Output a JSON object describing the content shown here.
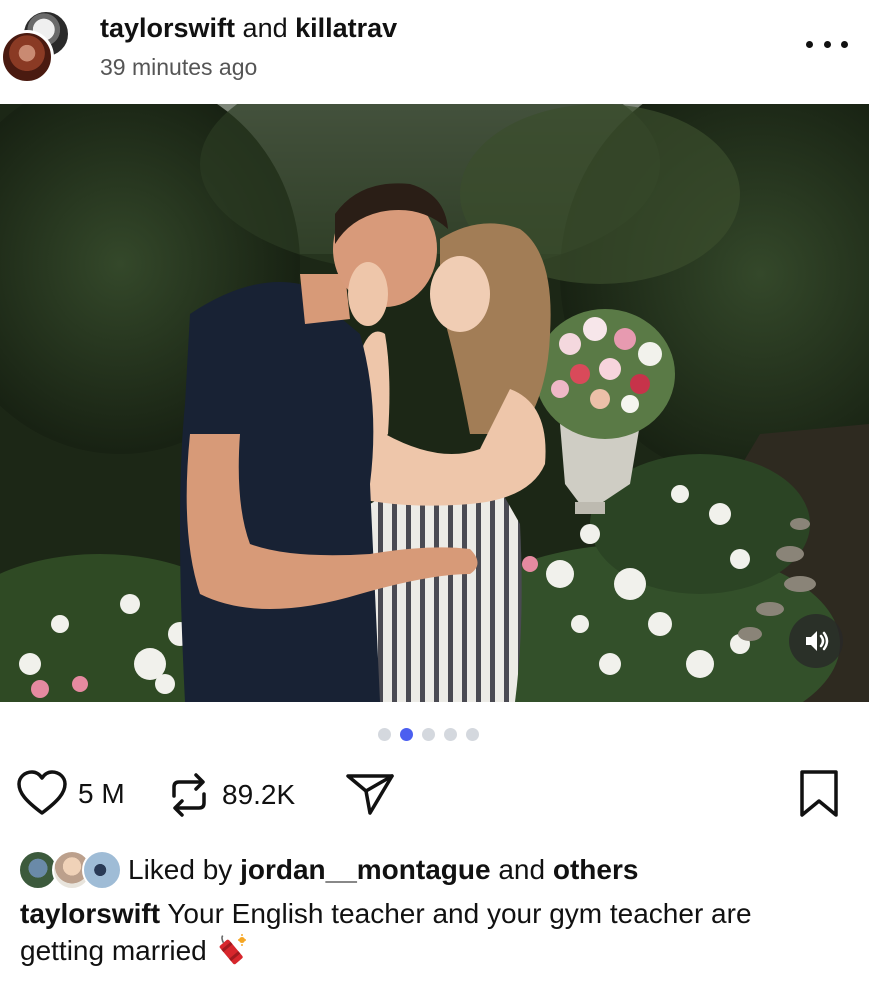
{
  "post": {
    "author_primary": "taylorswift",
    "connector": "and",
    "author_secondary": "killatrav",
    "timestamp": "39 minutes ago"
  },
  "media": {
    "page_count": 5,
    "active_page": 1,
    "sound_icon": "speaker-icon"
  },
  "actions": {
    "like_count": "5 M",
    "repost_count": "89.2K",
    "icons": [
      "heart-icon",
      "repost-icon",
      "send-icon",
      "bookmark-icon"
    ]
  },
  "likes": {
    "prefix": "Liked by",
    "user": "jordan__montague",
    "connector": "and",
    "others": "others"
  },
  "caption": {
    "username": "taylorswift",
    "text": "Your English teacher and your gym teacher are getting married",
    "emoji_icon": "firecracker-icon"
  },
  "colors": {
    "active_dot": "#4b5ff0",
    "inactive_dot": "#d4d8de"
  }
}
